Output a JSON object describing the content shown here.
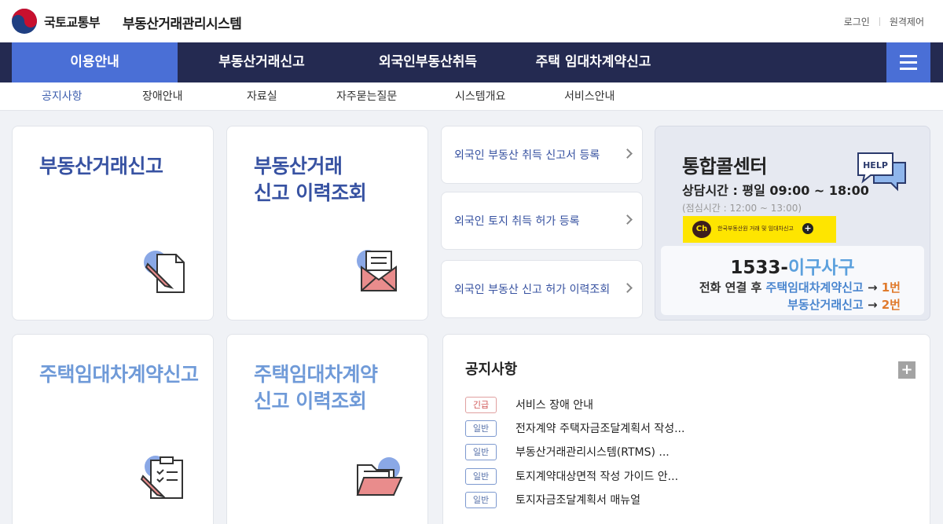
{
  "header": {
    "ministry": "국토교통부",
    "system_title": "부동산거래관리시스템",
    "login": "로그인",
    "remote": "원격제어"
  },
  "gnb": {
    "items": [
      {
        "label": "이용안내",
        "active": true
      },
      {
        "label": "부동산거래신고",
        "active": false
      },
      {
        "label": "외국인부동산취득",
        "active": false
      },
      {
        "label": "주택 임대차계약신고",
        "active": false
      }
    ]
  },
  "subnav": {
    "items": [
      {
        "label": "공지사항",
        "active": true
      },
      {
        "label": "장애안내",
        "active": false
      },
      {
        "label": "자료실",
        "active": false
      },
      {
        "label": "자주묻는질문",
        "active": false
      },
      {
        "label": "시스템개요",
        "active": false
      },
      {
        "label": "서비스안내",
        "active": false
      }
    ]
  },
  "cards": {
    "real_estate_report": {
      "line1": "부동산거래신고",
      "line2": ""
    },
    "real_estate_history": {
      "line1": "부동산거래",
      "line2": "신고 이력조회"
    },
    "housing_lease_report": {
      "line1": "주택임대차계약신고",
      "line2": ""
    },
    "housing_lease_history": {
      "line1": "주택임대차계약",
      "line2": "신고 이력조회"
    }
  },
  "links": [
    {
      "label": "외국인 부동산 취득 신고서 등록"
    },
    {
      "label": "외국인 토지 취득 허가 등록"
    },
    {
      "label": "외국인 부동산 신고 허가 이력조회"
    }
  ],
  "callcenter": {
    "title": "통합콜센터",
    "hours": "상담시간 : 평일 09:00 ~ 18:00",
    "lunch": "(점심시간 : 12:00 ~ 13:00)",
    "kakao_ch": "Ch",
    "kakao_text": "한국부동산원 거래 및 임대차신고",
    "kakao_plus": "+",
    "help_text": "HELP",
    "phone_prefix": "1533-",
    "phone_highlight": "이구사구",
    "route1_prefix": "전화 연결 후 ",
    "route1_service": "주택임대차계약신고",
    "route1_arrow": " → ",
    "route1_num": "1번",
    "route2_service": "부동산거래신고",
    "route2_arrow": " → ",
    "route2_num": "2번"
  },
  "notice": {
    "title": "공지사항",
    "more": "+",
    "rows": [
      {
        "badge": "긴급",
        "type": "urgent",
        "text": "서비스 장애 안내"
      },
      {
        "badge": "일반",
        "type": "normal",
        "text": "전자계약 주택자금조달계획서 작성..."
      },
      {
        "badge": "일반",
        "type": "normal",
        "text": "부동산거래관리시스템(RTMS) ..."
      },
      {
        "badge": "일반",
        "type": "normal",
        "text": "토지계약대상면적 작성 가이드 안..."
      },
      {
        "badge": "일반",
        "type": "normal",
        "text": "토지자금조달계획서 매뉴얼"
      }
    ]
  },
  "colors": {
    "gnb_bg": "#242a51",
    "accent": "#4a6fd6",
    "title_blue": "#3752a2",
    "title_light": "#6f9ad8",
    "kakao": "#fee500"
  }
}
